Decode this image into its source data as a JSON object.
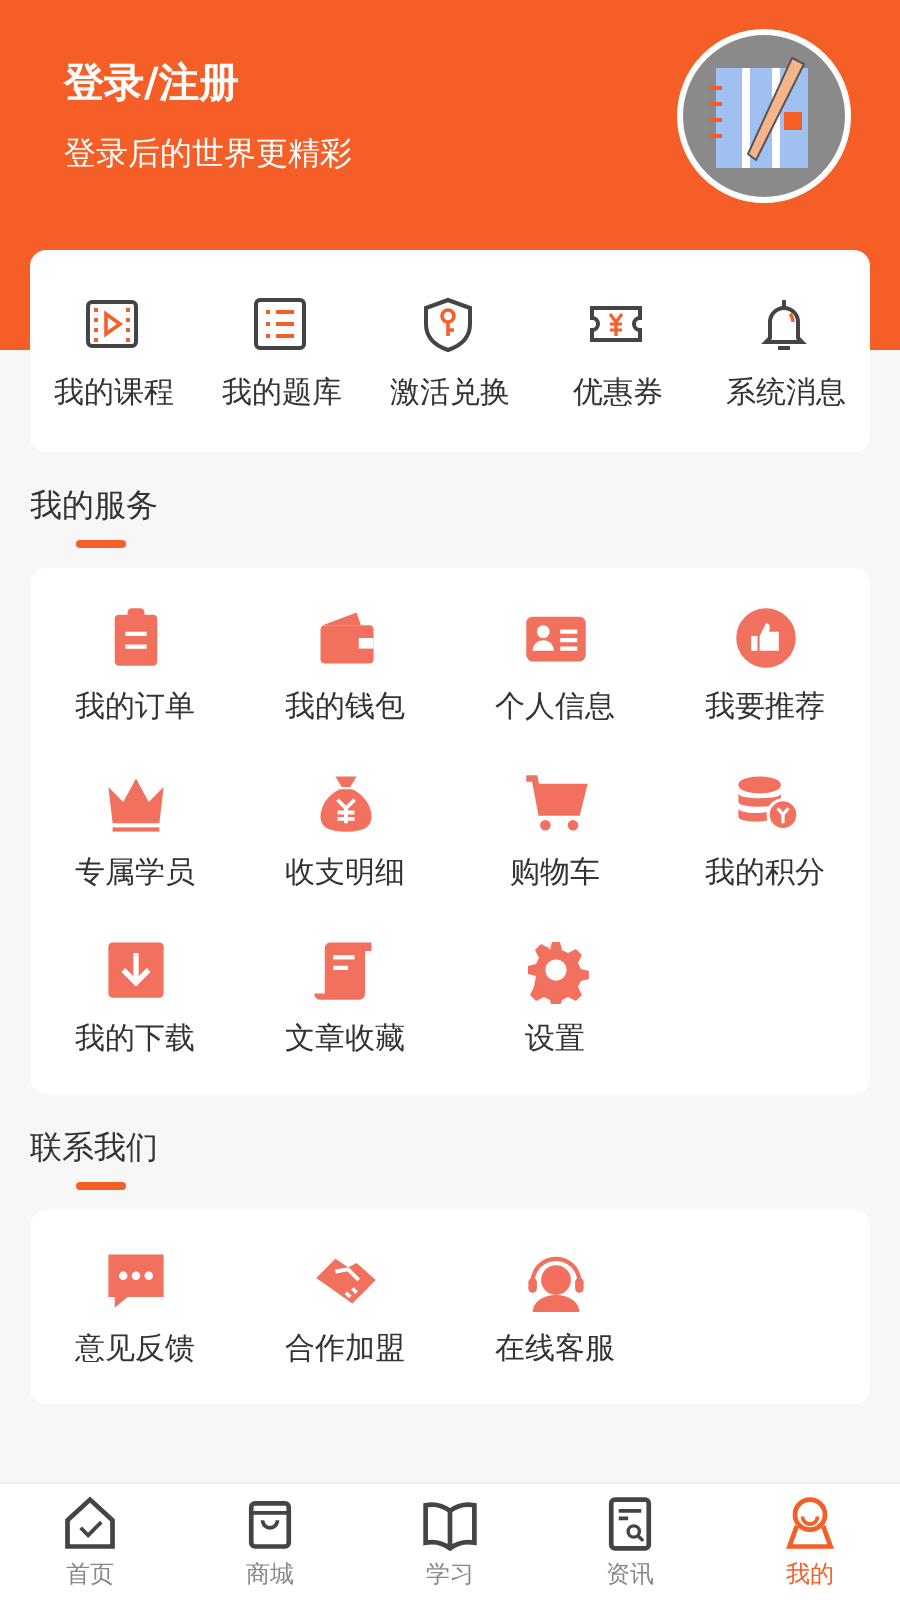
{
  "header": {
    "title": "登录/注册",
    "subtitle": "登录后的世界更精彩"
  },
  "shortcuts": [
    {
      "label": "我的课程"
    },
    {
      "label": "我的题库"
    },
    {
      "label": "激活兑换"
    },
    {
      "label": "优惠券"
    },
    {
      "label": "系统消息"
    }
  ],
  "services": {
    "title": "我的服务",
    "items": [
      {
        "label": "我的订单"
      },
      {
        "label": "我的钱包"
      },
      {
        "label": "个人信息"
      },
      {
        "label": "我要推荐"
      },
      {
        "label": "专属学员"
      },
      {
        "label": "收支明细"
      },
      {
        "label": "购物车"
      },
      {
        "label": "我的积分"
      },
      {
        "label": "我的下载"
      },
      {
        "label": "文章收藏"
      },
      {
        "label": "设置"
      }
    ]
  },
  "contact": {
    "title": "联系我们",
    "items": [
      {
        "label": "意见反馈"
      },
      {
        "label": "合作加盟"
      },
      {
        "label": "在线客服"
      }
    ]
  },
  "tabs": [
    {
      "label": "首页",
      "selected": false
    },
    {
      "label": "商城",
      "selected": false
    },
    {
      "label": "学习",
      "selected": false
    },
    {
      "label": "资讯",
      "selected": false
    },
    {
      "label": "我的",
      "selected": true
    }
  ]
}
